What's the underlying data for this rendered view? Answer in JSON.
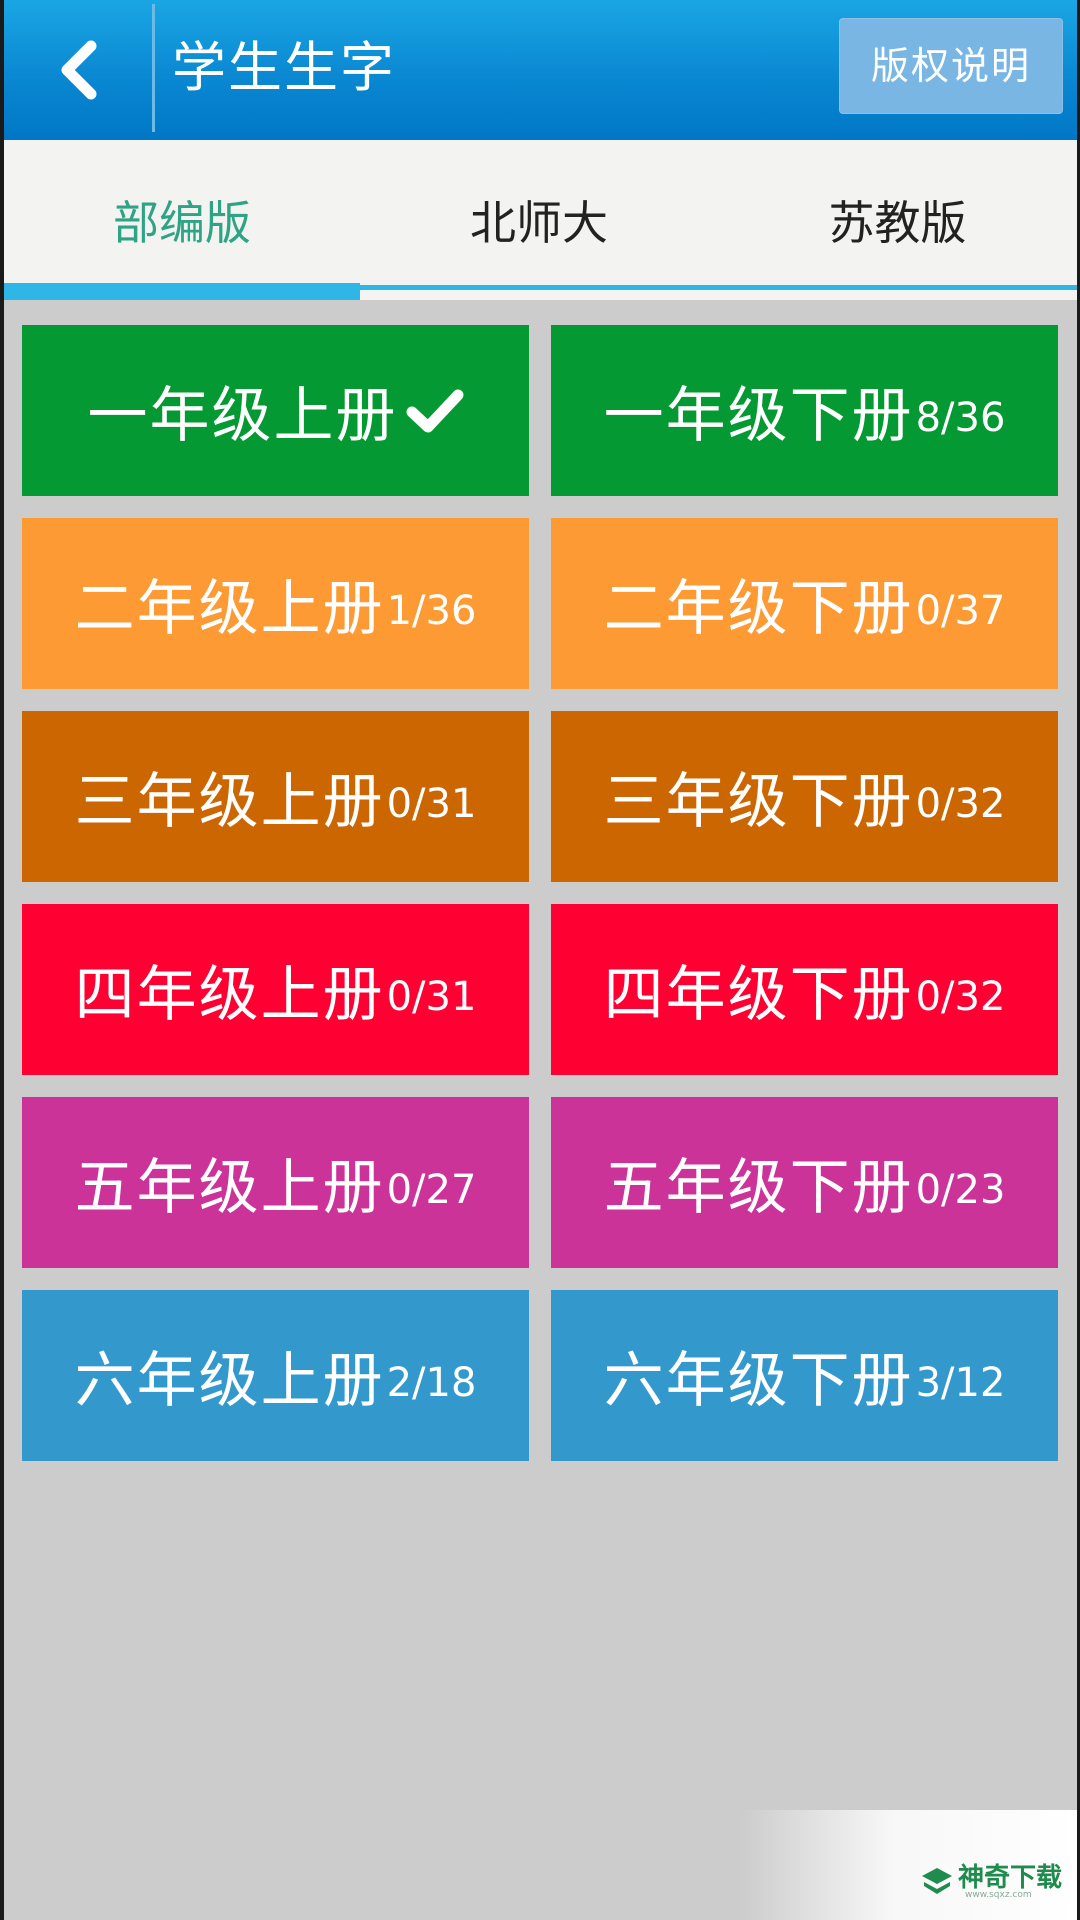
{
  "header": {
    "title": "学生生字",
    "copyright_label": "版权说明"
  },
  "tabs": [
    {
      "label": "部编版",
      "active": true
    },
    {
      "label": "北师大",
      "active": false
    },
    {
      "label": "苏教版",
      "active": false
    }
  ],
  "grades": [
    {
      "left": {
        "name": "一年级上册",
        "count": "",
        "completed": true
      },
      "right": {
        "name": "一年级下册",
        "count": "8/36",
        "completed": false
      },
      "color": "#049933"
    },
    {
      "left": {
        "name": "二年级上册",
        "count": "1/36",
        "completed": false
      },
      "right": {
        "name": "二年级下册",
        "count": "0/37",
        "completed": false
      },
      "color": "#fe9a34"
    },
    {
      "left": {
        "name": "三年级上册",
        "count": "0/31",
        "completed": false
      },
      "right": {
        "name": "三年级下册",
        "count": "0/32",
        "completed": false
      },
      "color": "#cc6600"
    },
    {
      "left": {
        "name": "四年级上册",
        "count": "0/31",
        "completed": false
      },
      "right": {
        "name": "四年级下册",
        "count": "0/32",
        "completed": false
      },
      "color": "#ff0033"
    },
    {
      "left": {
        "name": "五年级上册",
        "count": "0/27",
        "completed": false
      },
      "right": {
        "name": "五年级下册",
        "count": "0/23",
        "completed": false
      },
      "color": "#cb3399"
    },
    {
      "left": {
        "name": "六年级上册",
        "count": "2/18",
        "completed": false
      },
      "right": {
        "name": "六年级下册",
        "count": "3/12",
        "completed": false
      },
      "color": "#3399cc"
    }
  ],
  "icons": {
    "back": "chevron-left-icon",
    "check": "check-icon",
    "watermark_logo": "sqxz-logo-icon"
  },
  "watermark": {
    "text": "神奇下载",
    "sub": "www.sqxz.com"
  },
  "colors": {
    "header": "#0a88d2",
    "tab_active": "#2fa385",
    "tab_indicator": "#2eb6e6",
    "background": "#cccccc"
  }
}
